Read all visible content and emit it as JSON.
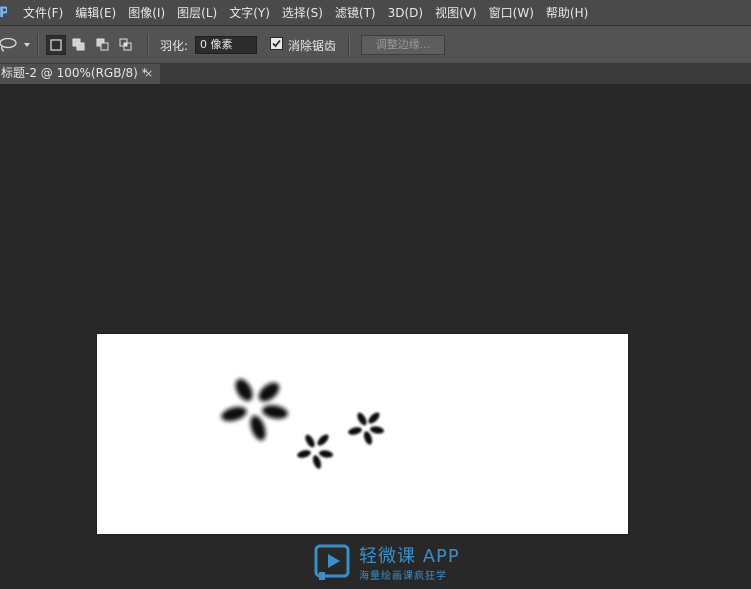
{
  "app": {
    "logo": "Ps"
  },
  "menu": [
    {
      "label": "文件(F)"
    },
    {
      "label": "编辑(E)"
    },
    {
      "label": "图像(I)"
    },
    {
      "label": "图层(L)"
    },
    {
      "label": "文字(Y)"
    },
    {
      "label": "选择(S)"
    },
    {
      "label": "滤镜(T)"
    },
    {
      "label": "3D(D)"
    },
    {
      "label": "视图(V)"
    },
    {
      "label": "窗口(W)"
    },
    {
      "label": "帮助(H)"
    }
  ],
  "options": {
    "tool_icon": "lasso-icon",
    "feather_label": "羽化:",
    "feather_value": "0 像素",
    "antialias_label": "消除锯齿",
    "antialias_checked": true,
    "refine_edge_label": "调整边缘..."
  },
  "document_tab": {
    "title": "标题-2 @ 100%(RGB/8) *",
    "close_glyph": "×"
  },
  "watermark": {
    "title": "轻微课 APP",
    "subtitle": "海量绘画课疯狂学",
    "color": "#3a8fc9"
  },
  "colors": {
    "menubar": "#4a4a4a",
    "optionsbar": "#535353",
    "workspace": "#282828",
    "canvas": "#ffffff"
  }
}
